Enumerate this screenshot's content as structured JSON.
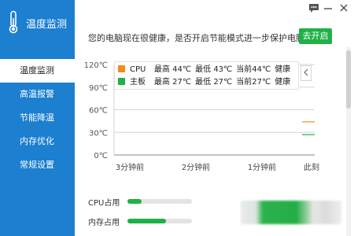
{
  "app": {
    "title": "温度监测"
  },
  "sidebar": {
    "items": [
      {
        "label": "温度监测",
        "active": true
      },
      {
        "label": "高温报警",
        "active": false
      },
      {
        "label": "节能降温",
        "active": false
      },
      {
        "label": "内存优化",
        "active": false
      },
      {
        "label": "常规设置",
        "active": false
      }
    ]
  },
  "notice": {
    "text": "您的电脑现在很健康，是否开启节能模式进一步保护电脑？",
    "button_label": "去开启"
  },
  "legend": {
    "rows": [
      {
        "name": "CPU",
        "max_label": "最高 44℃",
        "min_label": "最低 43℃",
        "current_label": "当前44℃",
        "status": "健康"
      },
      {
        "name": "主板",
        "max_label": "最高 27℃",
        "min_label": "最低 27℃",
        "current_label": "当前27℃",
        "status": "健康"
      }
    ],
    "collapse_icon": "chevron-left-icon"
  },
  "chart_data": {
    "type": "line",
    "y_ticks": [
      "120℃",
      "90℃",
      "60℃",
      "30℃",
      "0℃"
    ],
    "ylim": [
      0,
      120
    ],
    "x_ticks": [
      "3分钟前",
      "2分钟前",
      "1分钟前",
      "此刻"
    ],
    "grid": true,
    "series": [
      {
        "name": "CPU",
        "color": "#f58a1f",
        "values": [
          44,
          44
        ]
      },
      {
        "name": "主板",
        "color": "#1fb146",
        "values": [
          27,
          27
        ]
      }
    ]
  },
  "usage": {
    "cpu": {
      "label": "CPU占用",
      "fraction": 0.22
    },
    "memory": {
      "label": "内存占用",
      "fraction": 0.6
    }
  },
  "colors": {
    "sidebar": "#1c7fcf",
    "accent_green": "#1fb146",
    "cpu_orange": "#f58a1f"
  }
}
